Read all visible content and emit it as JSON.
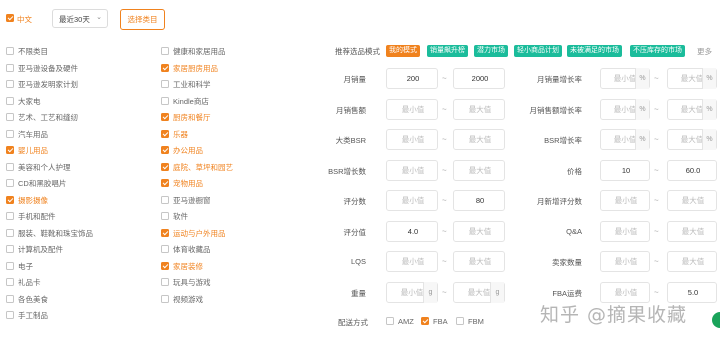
{
  "top": {
    "region_label": "中文",
    "date_range": "最近30天",
    "choose_category": "选择类目"
  },
  "categories_left": [
    {
      "label": "不限类目",
      "checked": false
    },
    {
      "label": "亚马逊设备及硬件",
      "checked": false
    },
    {
      "label": "亚马逊发明家计划",
      "checked": false
    },
    {
      "label": "大家电",
      "checked": false
    },
    {
      "label": "艺术、工艺和缝纫",
      "checked": false
    },
    {
      "label": "汽车用品",
      "checked": false
    },
    {
      "label": "婴儿用品",
      "checked": true
    },
    {
      "label": "美容和个人护理",
      "checked": false
    },
    {
      "label": "CD和黑胶唱片",
      "checked": false
    },
    {
      "label": "摄影摄像",
      "checked": true
    },
    {
      "label": "手机和配件",
      "checked": false
    },
    {
      "label": "服装、鞋靴和珠宝饰品",
      "checked": false
    },
    {
      "label": "计算机及配件",
      "checked": false
    },
    {
      "label": "电子",
      "checked": false
    },
    {
      "label": "礼品卡",
      "checked": false
    },
    {
      "label": "各色美食",
      "checked": false
    },
    {
      "label": "手工制品",
      "checked": false
    }
  ],
  "categories_right": [
    {
      "label": "健康和家居用品",
      "checked": false
    },
    {
      "label": "家居厨房用品",
      "checked": true
    },
    {
      "label": "工业和科学",
      "checked": false
    },
    {
      "label": "Kindle商店",
      "checked": false
    },
    {
      "label": "厨房和餐厅",
      "checked": true
    },
    {
      "label": "乐器",
      "checked": true
    },
    {
      "label": "办公用品",
      "checked": true
    },
    {
      "label": "庭院、草坪和园艺",
      "checked": true
    },
    {
      "label": "宠物用品",
      "checked": true
    },
    {
      "label": "亚马逊橱窗",
      "checked": false
    },
    {
      "label": "软件",
      "checked": false
    },
    {
      "label": "运动与户外用品",
      "checked": true
    },
    {
      "label": "体育收藏品",
      "checked": false
    },
    {
      "label": "家居装修",
      "checked": true
    },
    {
      "label": "玩具与游戏",
      "checked": false
    },
    {
      "label": "视频游戏",
      "checked": false
    }
  ],
  "mode": {
    "label": "推荐选品模式",
    "more": "更多",
    "tags": [
      {
        "label": "我的模式",
        "color": "#f0821e"
      },
      {
        "label": "销量飙升榜",
        "color": "#1bbc9b"
      },
      {
        "label": "潜力市场",
        "color": "#1bbc9b"
      },
      {
        "label": "轻小商品计划",
        "color": "#1bbc9b"
      },
      {
        "label": "未被满足的市场",
        "color": "#1bbc9b"
      },
      {
        "label": "不压库存的市场",
        "color": "#1bbc9b"
      }
    ]
  },
  "left_filters": [
    {
      "label": "月销量",
      "min": "200",
      "max": "2000",
      "unit": ""
    },
    {
      "label": "月销售额",
      "min": "最小值",
      "max": "最大值",
      "unit": ""
    },
    {
      "label": "大类BSR",
      "min": "最小值",
      "max": "最大值",
      "unit": ""
    },
    {
      "label": "BSR增长数",
      "min": "最小值",
      "max": "最大值",
      "unit": ""
    },
    {
      "label": "评分数",
      "min": "最小值",
      "max": "80",
      "unit": ""
    },
    {
      "label": "评分值",
      "min": "4.0",
      "max": "最大值",
      "unit": ""
    },
    {
      "label": "LQS",
      "min": "最小值",
      "max": "最大值",
      "unit": ""
    },
    {
      "label": "重量",
      "min": "最小值",
      "max": "最大值",
      "unit": "g"
    }
  ],
  "right_filters": [
    {
      "label": "月销量增长率",
      "min": "最小值",
      "max": "最大值",
      "unit": "%"
    },
    {
      "label": "月销售额增长率",
      "min": "最小值",
      "max": "最大值",
      "unit": "%"
    },
    {
      "label": "BSR增长率",
      "min": "最小值",
      "max": "最大值",
      "unit": "%"
    },
    {
      "label": "价格",
      "min": "10",
      "max": "60.0",
      "unit": ""
    },
    {
      "label": "月新增评分数",
      "min": "最小值",
      "max": "最大值",
      "unit": ""
    },
    {
      "label": "Q&A",
      "min": "最小值",
      "max": "最大值",
      "unit": ""
    },
    {
      "label": "卖家数量",
      "min": "最小值",
      "max": "最大值",
      "unit": ""
    },
    {
      "label": "FBA运费",
      "min": "最小值",
      "max": "5.0",
      "unit": ""
    }
  ],
  "delivery": {
    "label": "配送方式",
    "options": [
      {
        "label": "AMZ",
        "checked": false
      },
      {
        "label": "FBA",
        "checked": true
      },
      {
        "label": "FBM",
        "checked": false
      }
    ]
  },
  "watermark": "知乎 @摘果收藏"
}
